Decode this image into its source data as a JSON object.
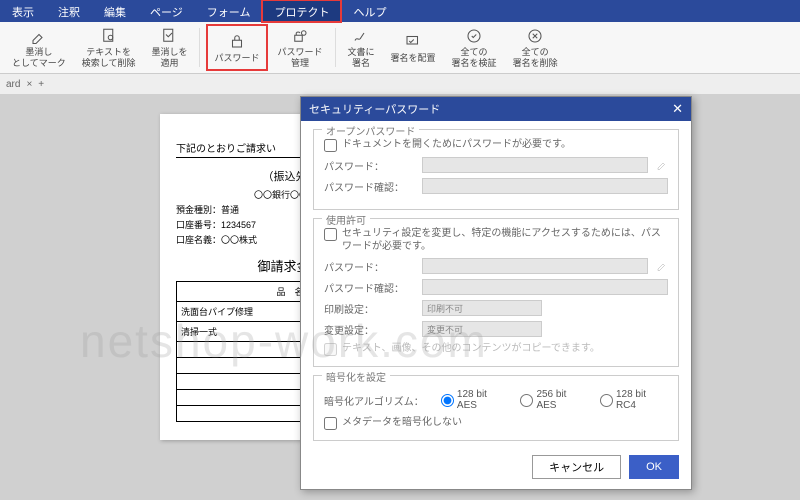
{
  "menu": {
    "items": [
      "表示",
      "注釈",
      "編集",
      "ページ",
      "フォーム",
      "プロテクト",
      "ヘルプ"
    ],
    "activeIndex": 5
  },
  "ribbon": {
    "items": [
      {
        "name": "redact-mark",
        "label": "墨消し\nとしてマーク"
      },
      {
        "name": "redact-search",
        "label": "テキストを\n検索して削除"
      },
      {
        "name": "redact-apply",
        "label": "墨消しを\n適用"
      },
      {
        "name": "password",
        "label": "パスワード",
        "hl": true
      },
      {
        "name": "password-manage",
        "label": "パスワード\n管理"
      },
      {
        "name": "doc-sign",
        "label": "文書に\n署名"
      },
      {
        "name": "place-sign",
        "label": "署名を配置"
      },
      {
        "name": "verify-all",
        "label": "全ての\n署名を検証"
      },
      {
        "name": "remove-all",
        "label": "全ての\n署名を削除"
      }
    ]
  },
  "tab": {
    "name": "ard",
    "close": "×",
    "add": "+"
  },
  "doc": {
    "intro": "下記のとおりご請求い",
    "bank_section": "（振込先）",
    "bank": "〇〇銀行〇〇支店",
    "acct_type": "預金種別：普通",
    "acct_no": "口座番号：1234567",
    "acct_name": "口座名義：〇〇株式",
    "amount_title": "御請求金額",
    "col_item": "品　名",
    "rows": [
      "洗面台パイプ修理",
      "清掃一式",
      "",
      "",
      "",
      "",
      ""
    ]
  },
  "watermark": "netshop-work.com",
  "dlg": {
    "title": "セキュリティーパスワード",
    "open": {
      "legend": "オープンパスワード",
      "chk": "ドキュメントを開くためにパスワードが必要です。",
      "pw": "パスワード：",
      "pw2": "パスワード確認："
    },
    "perm": {
      "legend": "使用許可",
      "chk": "セキュリティ設定を変更し、特定の機能にアクセスするためには、パスワードが必要です。",
      "pw": "パスワード：",
      "pw2": "パスワード確認：",
      "print": "印刷設定：",
      "print_v": "印刷不可",
      "change": "変更設定：",
      "change_v": "変更不可",
      "copy": "テキスト、画像、その他のコンテンツがコピーできます。"
    },
    "enc": {
      "legend": "暗号化を設定",
      "algo": "暗号化アルゴリズム：",
      "opts": [
        "128 bit AES",
        "256 bit AES",
        "128 bit RC4"
      ],
      "meta": "メタデータを暗号化しない"
    },
    "cancel": "キャンセル",
    "ok": "OK"
  }
}
